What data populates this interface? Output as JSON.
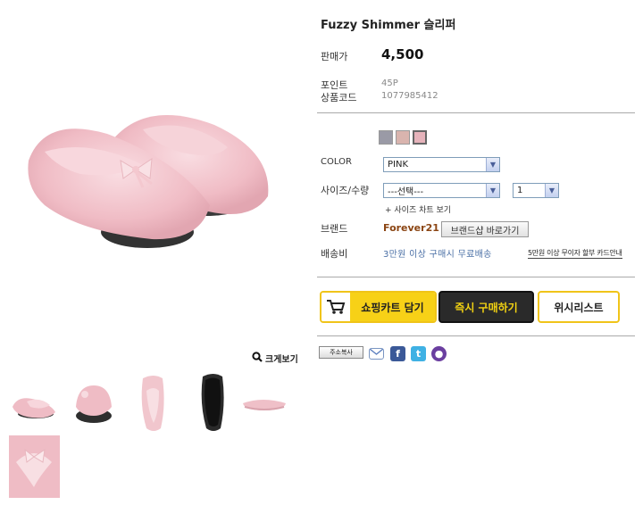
{
  "product": {
    "title": "Fuzzy Shimmer 슬리퍼",
    "price_label": "판매가",
    "price": "4,500",
    "point_label": "포인트",
    "point_value": "45P",
    "code_label": "상품코드",
    "code_value": "1077985412"
  },
  "options": {
    "color_label": "COLOR",
    "color_value": "PINK",
    "size_label": "사이즈/수량",
    "size_value": "---선택---",
    "qty_value": "1",
    "size_chart_link": "+ 사이즈 차트 보기",
    "swatches": [
      {
        "name": "gray",
        "color": "#9a9aa6"
      },
      {
        "name": "beige-pink",
        "color": "#d9b4ae"
      },
      {
        "name": "pink",
        "color": "#e6b3bb"
      }
    ]
  },
  "brand": {
    "label": "브랜드",
    "name": "Forever21",
    "shop_button": "브랜드샵 바로가기"
  },
  "shipping": {
    "label": "배송비",
    "text": "3만원 이상 구매시 무료배송",
    "installment_link": "5만원 이상 무이자 할부 카드안내"
  },
  "actions": {
    "cart": "쇼핑카트 담기",
    "buy_now": "즉시 구매하기",
    "wishlist": "위시리스트"
  },
  "share": {
    "copy_address": "주소복사"
  },
  "gallery": {
    "zoom_label": "크게보기"
  },
  "colors": {
    "accent_yellow": "#f7d117",
    "dark_button": "#2a2a2a",
    "brand_brown": "#8b4513",
    "shipping_blue": "#4a6fa5",
    "slipper_pink": "#f2c4cc"
  }
}
